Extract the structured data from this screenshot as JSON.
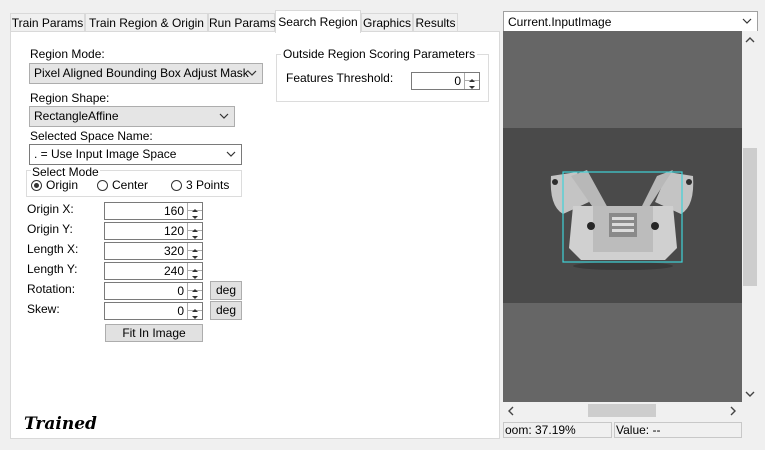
{
  "tabs": [
    {
      "label": "Train Params"
    },
    {
      "label": "Train Region & Origin"
    },
    {
      "label": "Run Params"
    },
    {
      "label": "Search Region"
    },
    {
      "label": "Graphics"
    },
    {
      "label": "Results"
    }
  ],
  "active_tab": "Search Region",
  "region_mode": {
    "label": "Region Mode:",
    "value": "Pixel Aligned Bounding Box Adjust Mask"
  },
  "region_shape": {
    "label": "Region Shape:",
    "value": "RectangleAffine"
  },
  "selected_space": {
    "label": "Selected Space Name:",
    "value": ". = Use Input Image Space"
  },
  "select_mode": {
    "label": "Select Mode",
    "options": [
      {
        "label": "Origin",
        "selected": true
      },
      {
        "label": "Center",
        "selected": false
      },
      {
        "label": "3 Points",
        "selected": false
      }
    ]
  },
  "params": {
    "origin_x": {
      "label": "Origin X:",
      "value": "160"
    },
    "origin_y": {
      "label": "Origin Y:",
      "value": "120"
    },
    "length_x": {
      "label": "Length X:",
      "value": "320"
    },
    "length_y": {
      "label": "Length Y:",
      "value": "240"
    },
    "rotation": {
      "label": "Rotation:",
      "value": "0",
      "unit_button": "deg"
    },
    "skew": {
      "label": "Skew:",
      "value": "0",
      "unit_button": "deg"
    }
  },
  "fit_button": "Fit In Image",
  "outside_group": {
    "title": "Outside Region Scoring Parameters",
    "threshold_label": "Features Threshold:",
    "threshold_value": "0"
  },
  "status_label": "Trained",
  "image_panel": {
    "image_selector": "Current.InputImage",
    "zoom": "oom: 37.19%",
    "value": "Value: --"
  },
  "colors": {
    "region_box": "#3fd3d8",
    "panel_bg": "#f0f0f0"
  },
  "icons": [
    "chevron-down-icon",
    "spin-up-icon",
    "spin-down-icon",
    "scroll-up-icon",
    "scroll-down-icon",
    "scroll-left-icon",
    "scroll-right-icon"
  ]
}
